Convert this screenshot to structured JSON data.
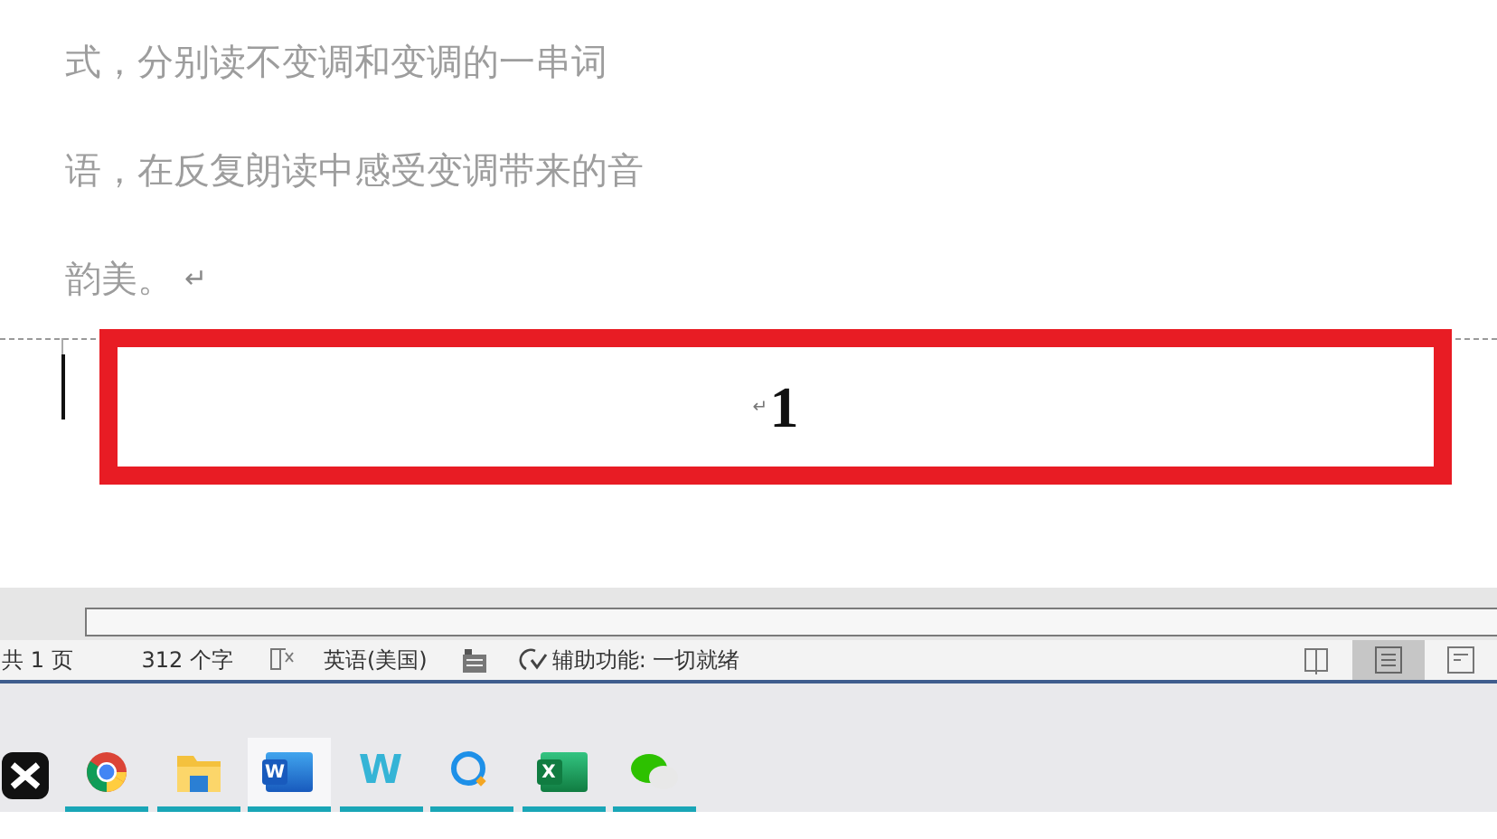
{
  "document": {
    "lines": [
      {
        "text": "式，分别读不变调和变调的一串词"
      },
      {
        "text": "语，在反复朗读中感受变调带来的音"
      },
      {
        "text": "韵美。",
        "mark": "↵"
      }
    ],
    "box": {
      "text": "1",
      "mark": "↵"
    }
  },
  "status_bar": {
    "page_count": "共 1 页",
    "word_count": "312 个字",
    "language": "英语(美国)",
    "accessibility": "辅助功能: 一切就绪",
    "views": [
      {
        "selected": false
      },
      {
        "selected": true
      },
      {
        "selected": false
      }
    ]
  },
  "taskbar": {
    "apps": [
      {
        "running": false,
        "selected": false
      },
      {
        "running": true,
        "selected": false
      },
      {
        "running": true,
        "selected": false
      },
      {
        "running": true,
        "selected": true,
        "glyph": "W"
      },
      {
        "running": true,
        "selected": false,
        "glyph": "W"
      },
      {
        "running": true,
        "selected": false
      },
      {
        "running": true,
        "selected": false,
        "glyph": "X"
      },
      {
        "running": true,
        "selected": false
      }
    ]
  }
}
